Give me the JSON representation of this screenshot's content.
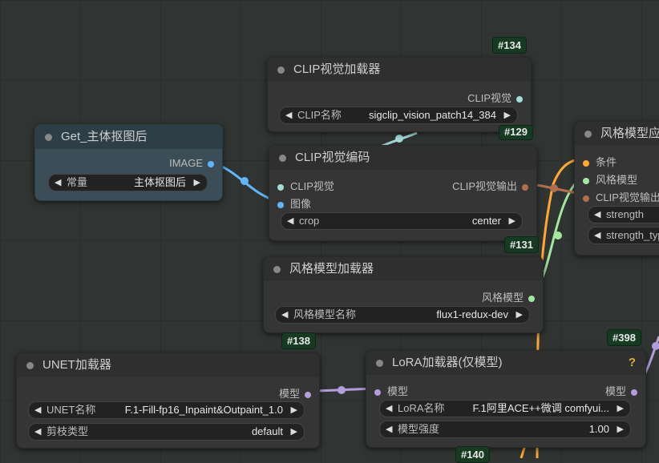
{
  "nodes": {
    "clip_loader": {
      "title": "CLIP视觉加载器",
      "badge": "#134",
      "out": "CLIP视觉",
      "w_name": "CLIP名称",
      "w_value": "sigclip_vision_patch14_384"
    },
    "get_node": {
      "title": "Get_主体抠图后",
      "out": "IMAGE",
      "w_name": "常量",
      "w_value": "主体抠图后"
    },
    "clip_encode": {
      "title": "CLIP视觉编码",
      "badge_top": "#129",
      "badge": "#131",
      "in1": "CLIP视觉",
      "in2": "图像",
      "out": "CLIP视觉输出",
      "w_name": "crop",
      "w_value": "center"
    },
    "style_apply": {
      "title": "风格模型应",
      "in1": "条件",
      "in2": "风格模型",
      "in3": "CLIP视觉输出",
      "w1": "strength",
      "w2": "strength_typ"
    },
    "style_loader": {
      "title": "风格模型加载器",
      "badge": "#138",
      "out": "风格模型",
      "w_name": "风格模型名称",
      "w_value": "flux1-redux-dev"
    },
    "unet_loader": {
      "title": "UNET加载器",
      "out": "模型",
      "w1_name": "UNET名称",
      "w1_value": "F.1-Fill-fp16_Inpaint&Outpaint_1.0",
      "w2_name": "剪枝类型",
      "w2_value": "default"
    },
    "lora_loader": {
      "title": "LoRA加载器(仅模型)",
      "badge": "#398",
      "badge_bottom": "#140",
      "help": "?",
      "in": "模型",
      "out": "模型",
      "w1_name": "LoRA名称",
      "w1_value": "F.1阿里ACE++微调 comfyui...",
      "w2_name": "模型强度",
      "w2_value": "1.00"
    }
  },
  "colors": {
    "clip_vision": "#a8dadc",
    "image": "#64b5f6",
    "clip_out": "#b07050",
    "style": "#a5e6a0",
    "cond": "#ffa931",
    "model": "#b39ddb"
  }
}
